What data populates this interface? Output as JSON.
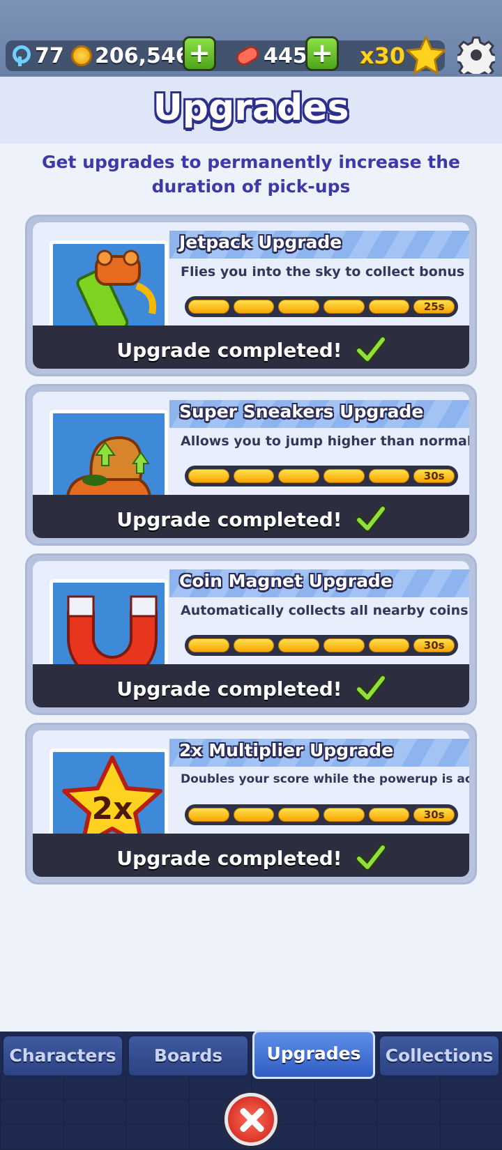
{
  "hud": {
    "keys": "77",
    "coins": "206,546",
    "boards": "445",
    "multiplier": "x30",
    "icons": [
      "key-icon",
      "coin-icon",
      "hoverboard-icon",
      "plus-icon",
      "star-icon",
      "gear-icon"
    ]
  },
  "page": {
    "title": "Upgrades",
    "subtitle": "Get upgrades to permanently increase the duration of pick-ups"
  },
  "upgrades": [
    {
      "name": "Jetpack Upgrade",
      "description": "Flies you into the sky to collect bonus coins",
      "level": 6,
      "max_level": 6,
      "duration": "25s",
      "status": "Upgrade completed!",
      "icon": "jetpack-icon"
    },
    {
      "name": "Super Sneakers Upgrade",
      "description": "Allows you to jump higher than normal",
      "level": 6,
      "max_level": 6,
      "duration": "30s",
      "status": "Upgrade completed!",
      "icon": "sneakers-icon"
    },
    {
      "name": "Coin Magnet Upgrade",
      "description": "Automatically collects all nearby coins",
      "level": 6,
      "max_level": 6,
      "duration": "30s",
      "status": "Upgrade completed!",
      "icon": "magnet-icon"
    },
    {
      "name": "2x Multiplier Upgrade",
      "description": "Doubles your score while the powerup is active",
      "level": 6,
      "max_level": 6,
      "duration": "30s",
      "status": "Upgrade completed!",
      "icon": "multiplier-star-icon",
      "icon_text": "2x"
    }
  ],
  "tabs": [
    {
      "label": "Characters",
      "active": false
    },
    {
      "label": "Boards",
      "active": false
    },
    {
      "label": "Upgrades",
      "active": true
    },
    {
      "label": "Collections",
      "active": false
    }
  ],
  "colors": {
    "accent": "#3d3aa8",
    "progress": "#ffd21f",
    "check": "#7ed321",
    "close": "#e0352a"
  }
}
